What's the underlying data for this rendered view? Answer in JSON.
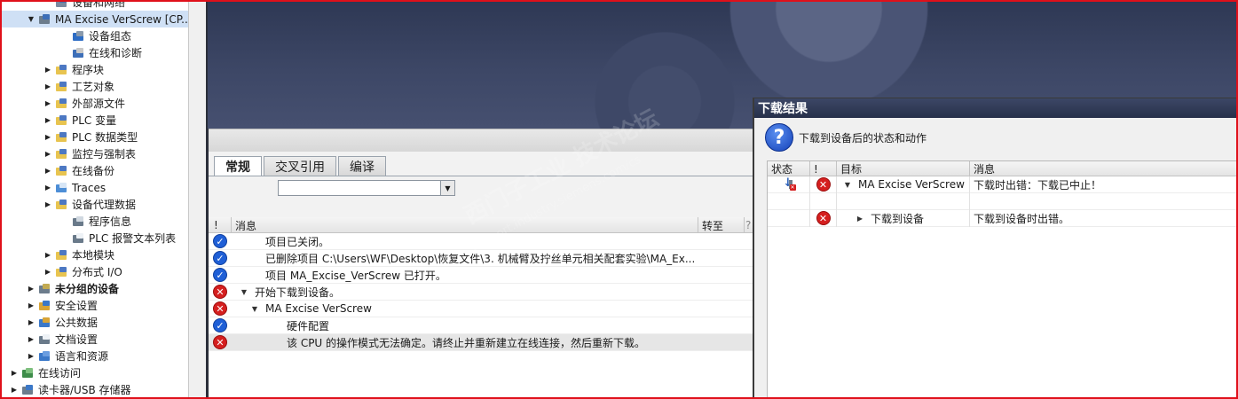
{
  "tree": {
    "items": [
      {
        "label": "设备和网络",
        "icon": "network-icon",
        "indent": 2,
        "twisty": "none"
      },
      {
        "label": "MA Excise VerScrew [CP...",
        "icon": "plc-icon",
        "indent": 1,
        "twisty": "open",
        "selected": true
      },
      {
        "label": "设备组态",
        "icon": "device-config-icon",
        "indent": 3,
        "twisty": "none"
      },
      {
        "label": "在线和诊断",
        "icon": "diagnostics-icon",
        "indent": 3,
        "twisty": "none"
      },
      {
        "label": "程序块",
        "icon": "folder-icon",
        "indent": 2,
        "twisty": "closed"
      },
      {
        "label": "工艺对象",
        "icon": "folder-icon",
        "indent": 2,
        "twisty": "closed"
      },
      {
        "label": "外部源文件",
        "icon": "folder-icon",
        "indent": 2,
        "twisty": "closed"
      },
      {
        "label": "PLC 变量",
        "icon": "folder-icon",
        "indent": 2,
        "twisty": "closed"
      },
      {
        "label": "PLC 数据类型",
        "icon": "folder-icon",
        "indent": 2,
        "twisty": "closed"
      },
      {
        "label": "监控与强制表",
        "icon": "folder-icon",
        "indent": 2,
        "twisty": "closed"
      },
      {
        "label": "在线备份",
        "icon": "folder-icon",
        "indent": 2,
        "twisty": "closed"
      },
      {
        "label": "Traces",
        "icon": "traces-icon",
        "indent": 2,
        "twisty": "closed"
      },
      {
        "label": "设备代理数据",
        "icon": "folder-icon",
        "indent": 2,
        "twisty": "closed"
      },
      {
        "label": "程序信息",
        "icon": "program-info-icon",
        "indent": 3,
        "twisty": "none"
      },
      {
        "label": "PLC 报警文本列表",
        "icon": "alarm-list-icon",
        "indent": 3,
        "twisty": "none"
      },
      {
        "label": "本地模块",
        "icon": "folder-icon",
        "indent": 2,
        "twisty": "closed"
      },
      {
        "label": "分布式 I/O",
        "icon": "folder-icon",
        "indent": 2,
        "twisty": "closed"
      },
      {
        "label": "未分组的设备",
        "icon": "devices-icon",
        "indent": 1,
        "twisty": "closed",
        "category": true
      },
      {
        "label": "安全设置",
        "icon": "security-icon",
        "indent": 1,
        "twisty": "closed"
      },
      {
        "label": "公共数据",
        "icon": "common-data-icon",
        "indent": 1,
        "twisty": "closed"
      },
      {
        "label": "文档设置",
        "icon": "document-icon",
        "indent": 1,
        "twisty": "closed"
      },
      {
        "label": "语言和资源",
        "icon": "language-icon",
        "indent": 1,
        "twisty": "closed"
      },
      {
        "label": "在线访问",
        "icon": "online-access-icon",
        "indent": 0,
        "twisty": "closed"
      },
      {
        "label": "读卡器/USB 存储器",
        "icon": "card-reader-icon",
        "indent": 0,
        "twisty": "closed"
      }
    ]
  },
  "info_panel": {
    "tabs": [
      "常规",
      "交叉引用",
      "编译"
    ],
    "active_tab": 0,
    "filter_value": "",
    "columns": {
      "flag": "!",
      "message": "消息",
      "goto": "转至",
      "extra": "?"
    },
    "rows": [
      {
        "status": "ok",
        "message": "项目已关闭。",
        "indent": 1,
        "expander": "none"
      },
      {
        "status": "ok",
        "message": "已删除项目 C:\\Users\\WF\\Desktop\\恢复文件\\3. 机械臂及拧丝单元相关配套实验\\MA_Ex...",
        "indent": 1,
        "expander": "none"
      },
      {
        "status": "ok",
        "message": "项目 MA_Excise_VerScrew 已打开。",
        "indent": 1,
        "expander": "none"
      },
      {
        "status": "err",
        "message": "开始下载到设备。",
        "indent": 0,
        "expander": "open"
      },
      {
        "status": "err",
        "message": "MA Excise VerScrew",
        "indent": 1,
        "expander": "open"
      },
      {
        "status": "ok",
        "message": "硬件配置",
        "indent": 3,
        "expander": "none"
      },
      {
        "status": "err",
        "message": "该 CPU 的操作模式无法确定。请终止并重新建立在线连接，然后重新下载。",
        "indent": 3,
        "expander": "none",
        "highlight": true
      }
    ]
  },
  "dialog": {
    "title": "下载结果",
    "subtitle": "下载到设备后的状态和动作",
    "columns": {
      "status": "状态",
      "flag": "!",
      "target": "目标",
      "message": "消息"
    },
    "rows": [
      {
        "status_icon": "download-error-icon",
        "flag": "err",
        "target": "MA Excise VerScrew",
        "message": "下载时出错：下载已中止！",
        "expander": "open",
        "indent": 0
      },
      {
        "status_icon": "",
        "flag": "",
        "target": "",
        "message": "",
        "expander": "none",
        "indent": 0
      },
      {
        "status_icon": "",
        "flag": "err",
        "target": "下载到设备",
        "message": "下载到设备时出错。",
        "expander": "closed",
        "indent": 1
      }
    ]
  },
  "watermark": {
    "main": "西门子工业 技术论坛",
    "sub": "support.industry.siemens.com/cs"
  },
  "colors": {
    "ok": "#1f5fd6",
    "error": "#d51f1f",
    "selection": "#cfe0f5",
    "dialog_title": "#27304a"
  }
}
